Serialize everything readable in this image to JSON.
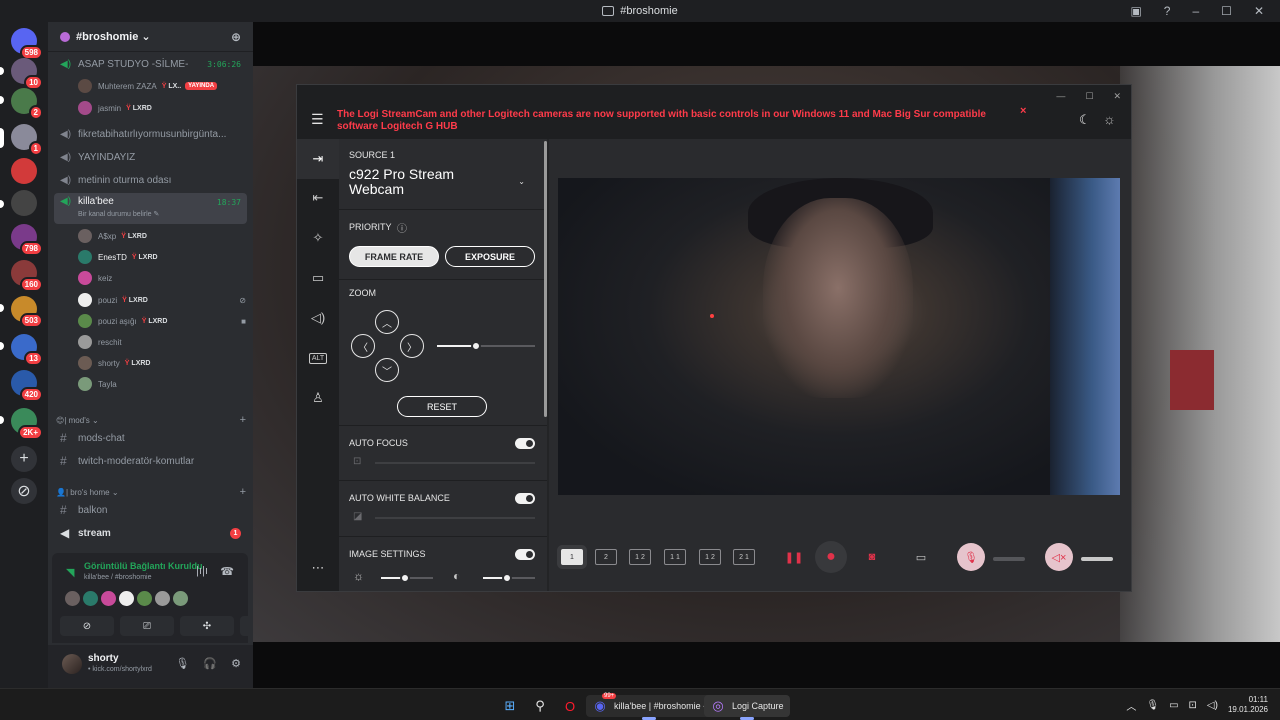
{
  "window": {
    "title": "#broshomie"
  },
  "rail": {
    "servers": [
      {
        "name": "discord-home",
        "badge": "598",
        "color": "#5865f2"
      },
      {
        "name": "server-1",
        "badge": "10",
        "color": "#6a5a7a"
      },
      {
        "name": "server-2",
        "badge": "2",
        "color": "#4a7a4a"
      },
      {
        "name": "server-3",
        "badge": "1",
        "color": "#8a8a9a"
      },
      {
        "name": "server-4",
        "badge": "",
        "color": "#d23a3a"
      },
      {
        "name": "server-5",
        "badge": "",
        "color": "#444"
      },
      {
        "name": "server-6",
        "badge": "798",
        "color": "#7a3a8a"
      },
      {
        "name": "server-7",
        "badge": "160",
        "color": "#8a3a3a"
      },
      {
        "name": "server-8",
        "badge": "503",
        "color": "#c88a2a"
      },
      {
        "name": "server-9",
        "badge": "13",
        "color": "#3a6aca"
      },
      {
        "name": "server-10",
        "badge": "420",
        "color": "#2a5aaa"
      },
      {
        "name": "server-11",
        "badge": "2K+",
        "color": "#3a8a5a"
      }
    ],
    "add_server": "+",
    "discover": "⊘"
  },
  "guild": {
    "name": "#broshomie ⌄",
    "channels": {
      "asap": "ASAP STUDYO -SİLME-",
      "asap_timer": "3:06:26",
      "fikret": "fikretabihatırlıyormusunbirgünta...",
      "yayindayiz": "YAYINDAYIZ",
      "metinin": "metinin oturma odası",
      "killabee": "killa'bee",
      "killabee_timer": "18:37",
      "killabee_status": "Bir kanal durumu belirle ✎",
      "mods_chat": "mods-chat",
      "twitch_mod": "twitch-moderatör-komutlar",
      "balkon": "balkon",
      "stream": "stream",
      "stream_unread": "1"
    },
    "asap_users": [
      {
        "name": "Muhterem ZAZA",
        "tag": "LX..",
        "live": "YAYINDA"
      },
      {
        "name": "jasmin",
        "tag": "LXRD",
        "live": ""
      }
    ],
    "killabee_users": [
      {
        "name": "A$xp",
        "tag": "LXRD"
      },
      {
        "name": "EnesTD",
        "tag": "LXRD"
      },
      {
        "name": "keiz",
        "tag": ""
      },
      {
        "name": "pouzi",
        "tag": "LXRD"
      },
      {
        "name": "pouzi aşığı",
        "tag": "LXRD"
      },
      {
        "name": "reschit",
        "tag": ""
      },
      {
        "name": "shorty",
        "tag": "LXRD"
      },
      {
        "name": "Tayla",
        "tag": ""
      }
    ],
    "categories": {
      "mods": "| mod's ⌄",
      "bros": "| bro's home ⌄"
    }
  },
  "voice_panel": {
    "status": "Görüntülü Bağlantı Kuruldu",
    "sub": "killa'bee / #broshomie"
  },
  "user": {
    "name": "shorty",
    "status": "• kick.com/shortylxrd"
  },
  "logi": {
    "banner": "The Logi StreamCam and other Logitech cameras are now supported with basic controls in our Windows 11 and Mac Big Sur compatible software Logitech G HUB",
    "banner_close": "×",
    "source_label": "SOURCE 1",
    "source_name": "c922 Pro Stream Webcam",
    "priority_label": "PRIORITY",
    "frame_rate": "FRAME RATE",
    "exposure": "EXPOSURE",
    "zoom_label": "ZOOM",
    "zoom_level": 0.4,
    "reset": "RESET",
    "auto_focus": "AUTO FOCUS",
    "auto_white_balance": "AUTO WHITE BALANCE",
    "image_settings": "IMAGE SETTINGS",
    "brightness_level": 0.47,
    "contrast_level": 0.47,
    "nav_alt": "ALT",
    "more": "⋯",
    "layouts": [
      "1",
      "2",
      "1 2",
      "1 1",
      "1 2",
      "2 1"
    ]
  },
  "taskbar": {
    "discord_badge": "99+",
    "discord_label": "killa'bee | #broshomie -",
    "logi_label": "Logi Capture",
    "time": "01:11",
    "date": "19.01.2026"
  }
}
